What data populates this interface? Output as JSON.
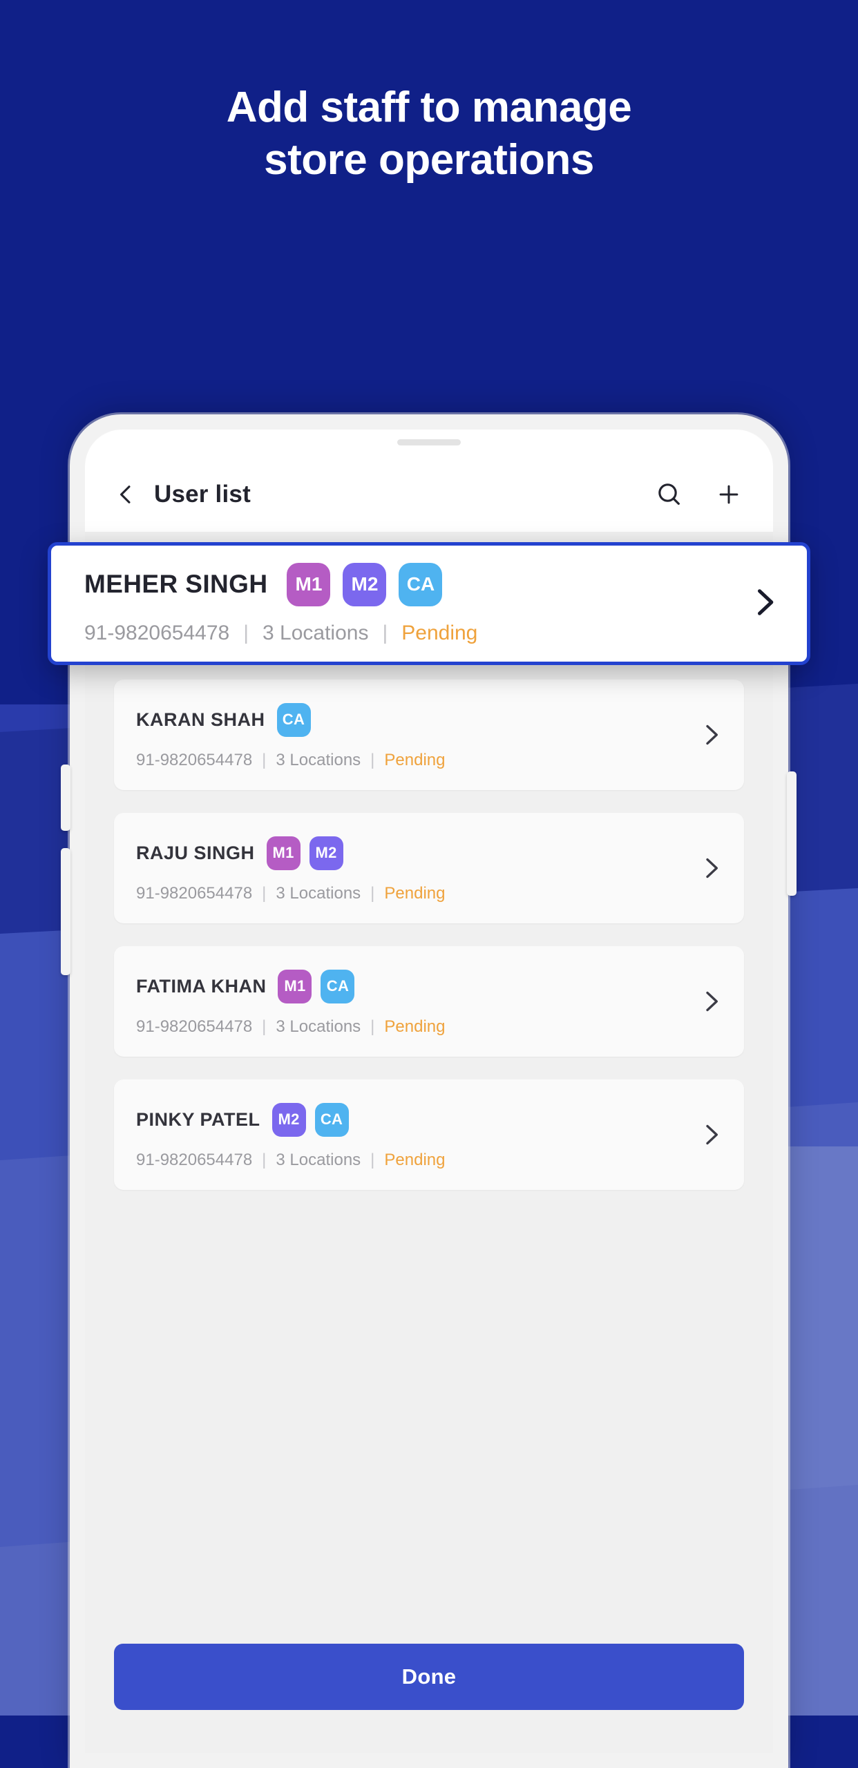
{
  "theme": {
    "background_blue": "#102088",
    "panel_blue_mid": "#2f44b5",
    "panel_blue_light": "#6474c4",
    "accent_blue": "#2342cf",
    "button_blue": "#3a4fcb",
    "status_orange": "#efa23c",
    "badge_m1": "#b55cc4",
    "badge_m2": "#7b68ee",
    "badge_ca": "#4fb3f0"
  },
  "promo": {
    "headline_line1": "Add staff to manage",
    "headline_line2": "store operations"
  },
  "appbar": {
    "back_icon": "chevron-left-icon",
    "title": "User list",
    "search_icon": "search-icon",
    "add_icon": "plus-icon"
  },
  "highlighted_user": {
    "name": "MEHER SINGH",
    "badges": [
      {
        "label": "M1",
        "color": "#b55cc4"
      },
      {
        "label": "M2",
        "color": "#7b68ee"
      },
      {
        "label": "CA",
        "color": "#4fb3f0"
      }
    ],
    "phone": "91-9820654478",
    "locations": "3 Locations",
    "status": "Pending",
    "separator": "|",
    "chevron_icon": "chevron-right-icon"
  },
  "users": [
    {
      "name": "KARAN SHAH",
      "badges": [
        {
          "label": "CA",
          "color": "#4fb3f0"
        }
      ],
      "phone": "91-9820654478",
      "locations": "3 Locations",
      "status": "Pending",
      "separator": "|"
    },
    {
      "name": "RAJU SINGH",
      "badges": [
        {
          "label": "M1",
          "color": "#b55cc4"
        },
        {
          "label": "M2",
          "color": "#7b68ee"
        }
      ],
      "phone": "91-9820654478",
      "locations": "3 Locations",
      "status": "Pending",
      "separator": "|"
    },
    {
      "name": "FATIMA KHAN",
      "badges": [
        {
          "label": "M1",
          "color": "#b55cc4"
        },
        {
          "label": "CA",
          "color": "#4fb3f0"
        }
      ],
      "phone": "91-9820654478",
      "locations": "3 Locations",
      "status": "Pending",
      "separator": "|"
    },
    {
      "name": "PINKY PATEL",
      "badges": [
        {
          "label": "M2",
          "color": "#7b68ee"
        },
        {
          "label": "CA",
          "color": "#4fb3f0"
        }
      ],
      "phone": "91-9820654478",
      "locations": "3 Locations",
      "status": "Pending",
      "separator": "|"
    }
  ],
  "footer": {
    "done_label": "Done"
  }
}
